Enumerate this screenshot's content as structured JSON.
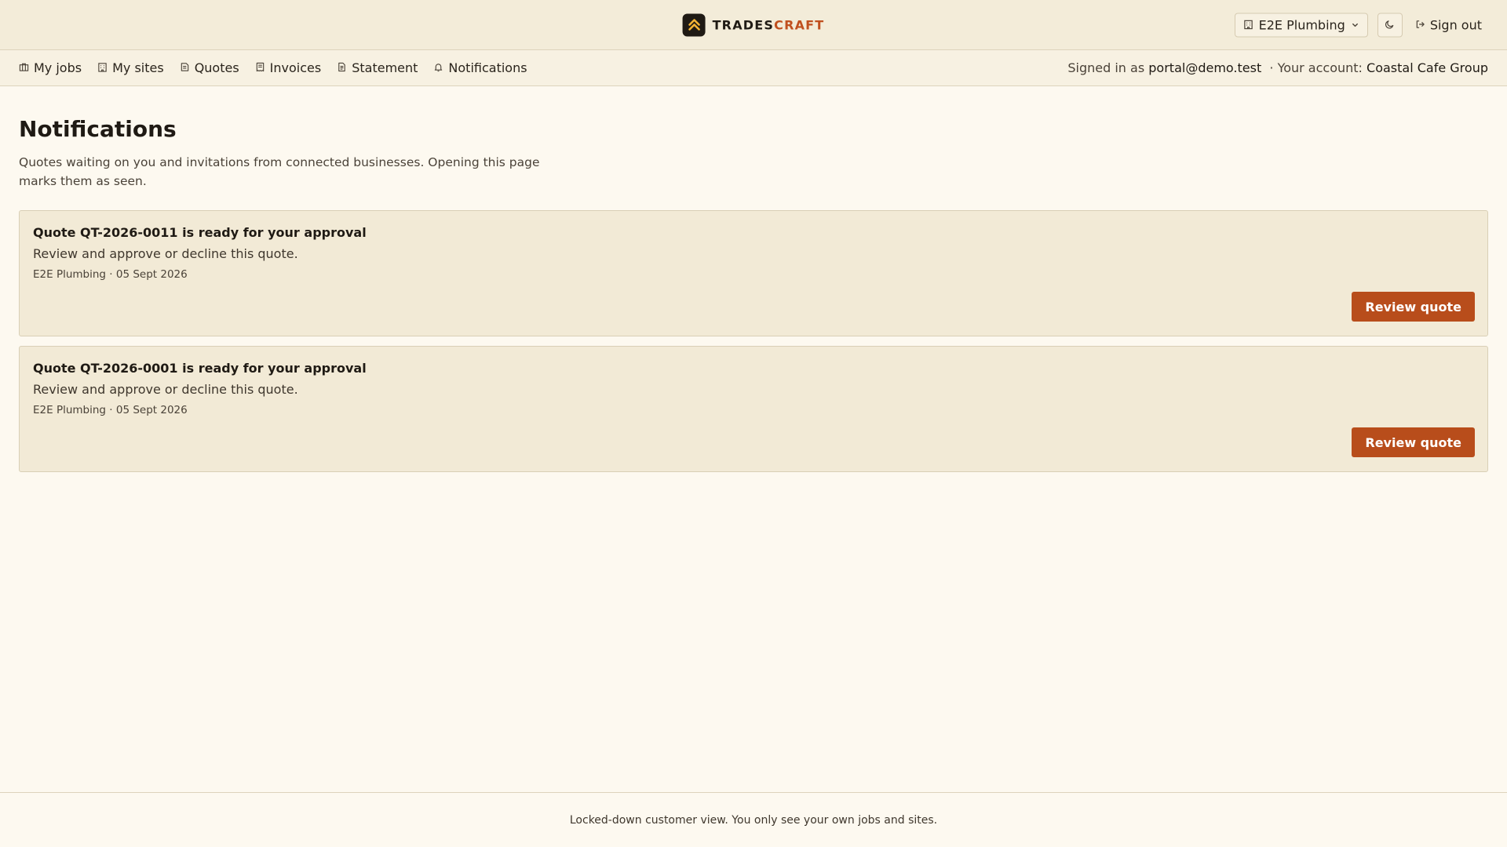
{
  "brand": {
    "name_part1": "TRADES",
    "name_part2": "CRAFT",
    "icon": "chevron-up-logo-icon",
    "accent_color": "#c0501f"
  },
  "topbar": {
    "org_selector": {
      "icon": "building-icon",
      "label": "E2E Plumbing",
      "chevron": "chevron-down-icon"
    },
    "theme_toggle": {
      "icon": "moon-icon"
    },
    "sign_out": {
      "icon": "sign-out-icon",
      "label": "Sign out"
    }
  },
  "nav": {
    "items": [
      {
        "id": "my-jobs",
        "label": "My jobs",
        "icon": "briefcase-icon"
      },
      {
        "id": "my-sites",
        "label": "My sites",
        "icon": "building-icon"
      },
      {
        "id": "quotes",
        "label": "Quotes",
        "icon": "quote-icon"
      },
      {
        "id": "invoices",
        "label": "Invoices",
        "icon": "receipt-icon"
      },
      {
        "id": "statement",
        "label": "Statement",
        "icon": "document-icon"
      },
      {
        "id": "notifications",
        "label": "Notifications",
        "icon": "bell-icon"
      }
    ],
    "signed_in_prefix": "Signed in as",
    "signed_in_email": "portal@demo.test",
    "account_prefix": "· Your account:",
    "account_name": "Coastal Cafe Group"
  },
  "main": {
    "title": "Notifications",
    "description": "Quotes waiting on you and invitations from connected businesses. Opening this page marks them as seen.",
    "notifications": [
      {
        "title": "Quote QT-2026-0011 is ready for your approval",
        "body": "Review and approve or decline this quote.",
        "meta": "E2E Plumbing · 05 Sept 2026",
        "action_label": "Review quote"
      },
      {
        "title": "Quote QT-2026-0001 is ready for your approval",
        "body": "Review and approve or decline this quote.",
        "meta": "E2E Plumbing · 05 Sept 2026",
        "action_label": "Review quote"
      }
    ]
  },
  "footer": {
    "text": "Locked-down customer view. You only see your own jobs and sites."
  },
  "colors": {
    "topbar_bg": "#f3ecd9",
    "page_bg": "#fdf9f0",
    "card_bg": "#f2ead6",
    "button_bg": "#b84d1b"
  }
}
